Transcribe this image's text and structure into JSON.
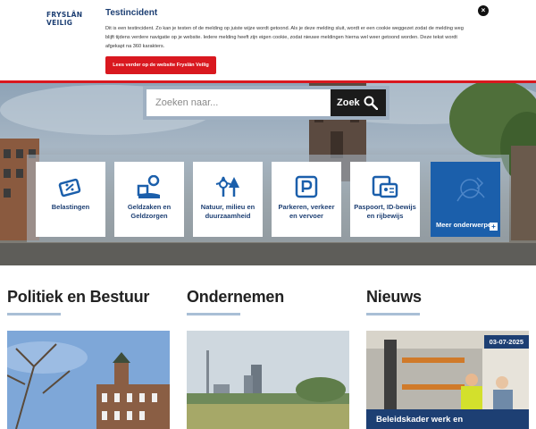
{
  "banner": {
    "logo_line1": "FRYSLÂN",
    "logo_line2": "VEILIG",
    "title": "Testincident",
    "text": "Dit is een testincident. Zo kan je testen of de melding op juiste wijze wordt getoond. Als je deze melding sluit, wordt er een cookie weggezet zodat de melding weg blijft tijdens verdere navigatie op je website. Iedere melding heeft zijn eigen cookie, zodat nieuwe meldingen hierna wel weer getoond worden. Deze tekst wordt afgekapt na 360 karakters.",
    "button_label": "Lees verder op de website Fryslân Veilig",
    "close_icon": "close-icon"
  },
  "search": {
    "placeholder": "Zoeken naar...",
    "button_label": "Zoek",
    "icon": "search-icon"
  },
  "tiles": [
    {
      "label": "Belastingen",
      "icon": "tax-icon"
    },
    {
      "label": "Geldzaken en Geldzorgen",
      "icon": "money-icon"
    },
    {
      "label": "Natuur, milieu en duurzaamheid",
      "icon": "nature-icon"
    },
    {
      "label": "Parkeren, verkeer en vervoer",
      "icon": "parking-icon"
    },
    {
      "label": "Paspoort, ID-bewijs en rijbewijs",
      "icon": "id-card-icon"
    },
    {
      "label": "Meer onderwerpen",
      "icon": "plus-icon"
    }
  ],
  "sections": [
    {
      "title": "Politiek en Bestuur"
    },
    {
      "title": "Ondernemen"
    },
    {
      "title": "Nieuws",
      "news_date": "03-07-2025",
      "news_title": "Beleidskader werk en"
    }
  ],
  "colors": {
    "brand_blue": "#1d3f73",
    "accent_red": "#d9181f",
    "tile_blue": "#1b5fab"
  }
}
